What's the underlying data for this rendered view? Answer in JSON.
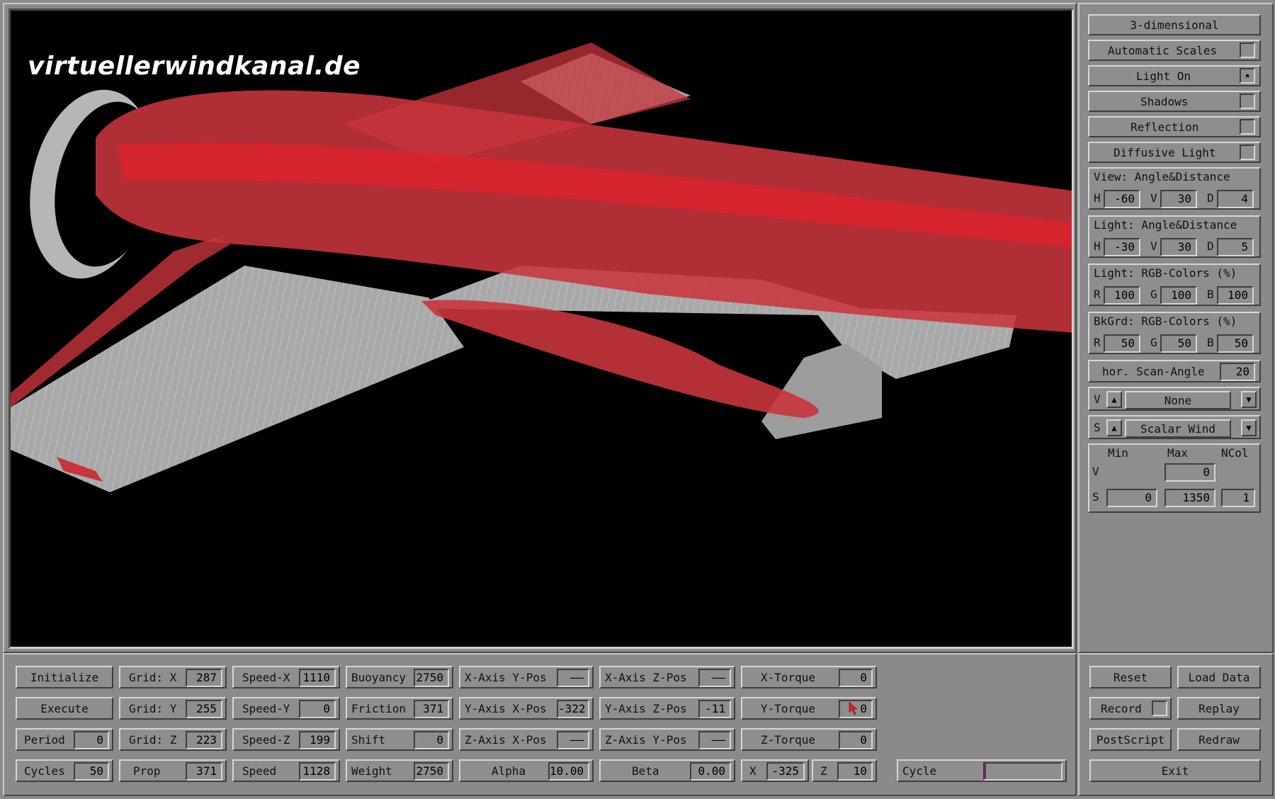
{
  "watermark": "virtuellerwindkanal.de",
  "side": {
    "mode_button": "3-dimensional",
    "toggles": [
      {
        "label": "Automatic Scales",
        "checked": false
      },
      {
        "label": "Light On",
        "checked": true
      },
      {
        "label": "Shadows",
        "checked": false
      },
      {
        "label": "Reflection",
        "checked": false
      },
      {
        "label": "Diffusive Light",
        "checked": false
      }
    ],
    "view": {
      "title": "View:  Angle&Distance",
      "h_label": "H",
      "h": "-60",
      "v_label": "V",
      "v": "30",
      "d_label": "D",
      "d": "4"
    },
    "light_angle": {
      "title": "Light: Angle&Distance",
      "h_label": "H",
      "h": "-30",
      "v_label": "V",
      "v": "30",
      "d_label": "D",
      "d": "5"
    },
    "light_rgb": {
      "title": "Light: RGB-Colors (%)",
      "r_label": "R",
      "r": "100",
      "g_label": "G",
      "g": "100",
      "b_label": "B",
      "b": "100"
    },
    "bkgrd_rgb": {
      "title": "BkGrd: RGB-Colors (%)",
      "r_label": "R",
      "r": "50",
      "g_label": "G",
      "g": "50",
      "b_label": "B",
      "b": "50"
    },
    "scan": {
      "label": "hor. Scan-Angle",
      "value": "20"
    },
    "v_select": {
      "prefix": "V",
      "value": "None"
    },
    "s_select": {
      "prefix": "S",
      "value": "Scalar Wind"
    },
    "ranges": {
      "min": "Min",
      "max": "Max",
      "ncol": "NCol",
      "v_label": "V",
      "v_max": "0",
      "s_label": "S",
      "s_min": "0",
      "s_max": "1350",
      "s_ncol": "1"
    }
  },
  "bottom": {
    "initialize": "Initialize",
    "execute": "Execute",
    "period": {
      "label": "Period",
      "value": "0"
    },
    "cycles": {
      "label": "Cycles",
      "value": "50"
    },
    "grid_x": {
      "label": "Grid: X",
      "value": "287"
    },
    "grid_y": {
      "label": "Grid: Y",
      "value": "255"
    },
    "grid_z": {
      "label": "Grid: Z",
      "value": "223"
    },
    "prop": {
      "label": "Prop",
      "value": "371"
    },
    "speed_x": {
      "label": "Speed-X",
      "value": "1110"
    },
    "speed_y": {
      "label": "Speed-Y",
      "value": "0"
    },
    "speed_z": {
      "label": "Speed-Z",
      "value": "199"
    },
    "speed": {
      "label": "Speed",
      "value": "1128"
    },
    "buoyancy": {
      "label": "Buoyancy",
      "value": "2750"
    },
    "friction": {
      "label": "Friction",
      "value": "371"
    },
    "shift": {
      "label": "Shift",
      "value": "0"
    },
    "weight": {
      "label": "Weight",
      "value": "2750"
    },
    "x_axis_y_pos": {
      "label": "X-Axis Y-Pos",
      "value": "——"
    },
    "y_axis_x_pos": {
      "label": "Y-Axis X-Pos",
      "value": "-322"
    },
    "z_axis_x_pos": {
      "label": "Z-Axis X-Pos",
      "value": "——"
    },
    "alpha": {
      "label": "Alpha",
      "value": "10.00"
    },
    "x_axis_z_pos": {
      "label": "X-Axis Z-Pos",
      "value": "——"
    },
    "y_axis_z_pos": {
      "label": "Y-Axis Z-Pos",
      "value": "-11"
    },
    "z_axis_y_pos": {
      "label": "Z-Axis Y-Pos",
      "value": "——"
    },
    "beta": {
      "label": "Beta",
      "value": "0.00"
    },
    "x_torque": {
      "label": "X-Torque",
      "value": "0"
    },
    "y_torque": {
      "label": "Y-Torque",
      "value": "0"
    },
    "z_torque": {
      "label": "Z-Torque",
      "value": "0"
    },
    "x_coord": {
      "label": "X",
      "value": "-325"
    },
    "z_coord": {
      "label": "Z",
      "value": "10"
    },
    "cycle": {
      "label": "Cycle",
      "progress": 0.02
    }
  },
  "actions": {
    "reset": "Reset",
    "load_data": "Load Data",
    "record": "Record",
    "replay": "Replay",
    "postscript": "PostScript",
    "redraw": "Redraw",
    "exit": "Exit"
  },
  "colors": {
    "fuselage": "#c8343c",
    "wing": "#a8a8a8",
    "panel": "#8e8e8e",
    "progress": "#8a1a8a"
  }
}
